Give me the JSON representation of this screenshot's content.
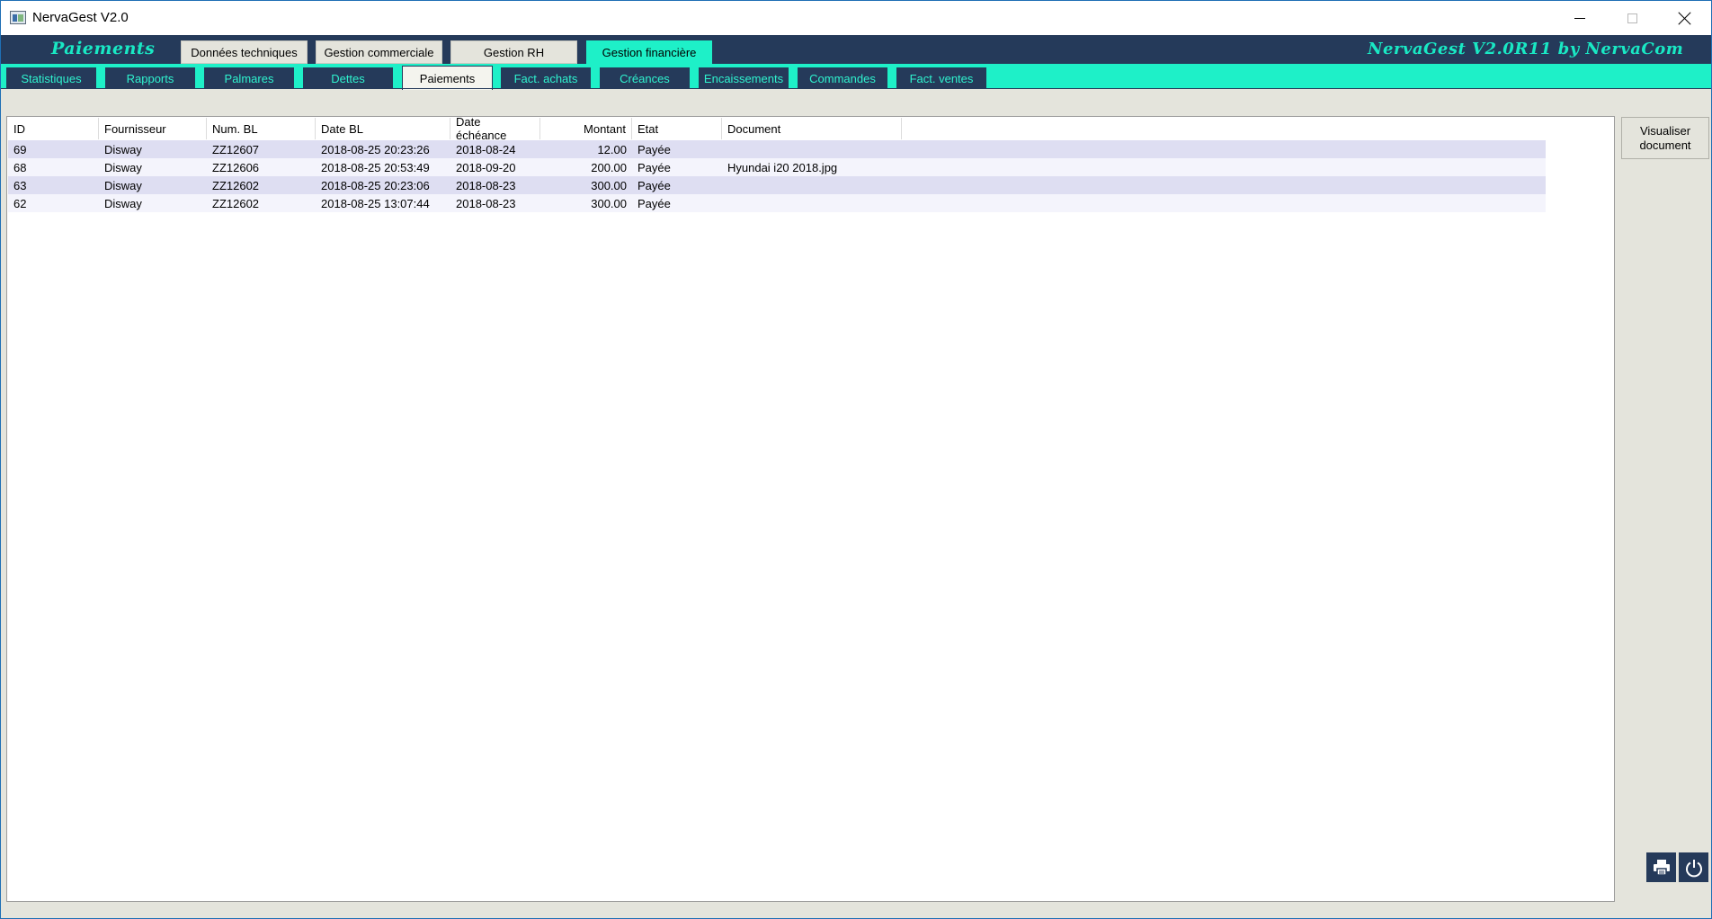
{
  "window": {
    "title": "NervaGest V2.0"
  },
  "header": {
    "section_title": "Paiements",
    "brand": "NervaGest V2.0R11 by NervaCom",
    "modules": [
      {
        "label": "Données techniques",
        "active": false
      },
      {
        "label": "Gestion commerciale",
        "active": false
      },
      {
        "label": "Gestion RH",
        "active": false
      },
      {
        "label": "Gestion financière",
        "active": true
      }
    ]
  },
  "tabs": [
    {
      "label": "Statistiques",
      "active": false
    },
    {
      "label": "Rapports",
      "active": false
    },
    {
      "label": "Palmares",
      "active": false
    },
    {
      "label": "Dettes",
      "active": false
    },
    {
      "label": "Paiements",
      "active": true
    },
    {
      "label": "Fact. achats",
      "active": false
    },
    {
      "label": "Créances",
      "active": false
    },
    {
      "label": "Encaissements",
      "active": false
    },
    {
      "label": "Commandes",
      "active": false
    },
    {
      "label": "Fact. ventes",
      "active": false
    }
  ],
  "table": {
    "columns": [
      "ID",
      "Fournisseur",
      "Num. BL",
      "Date BL",
      "Date échéance",
      "Montant",
      "Etat",
      "Document"
    ],
    "rows": [
      [
        "69",
        "Disway",
        "ZZ12607",
        "2018-08-25 20:23:26",
        "2018-08-24",
        "12.00",
        "Payée",
        ""
      ],
      [
        "68",
        "Disway",
        "ZZ12606",
        "2018-08-25 20:53:49",
        "2018-09-20",
        "200.00",
        "Payée",
        "Hyundai i20 2018.jpg"
      ],
      [
        "63",
        "Disway",
        "ZZ12602",
        "2018-08-25 20:23:06",
        "2018-08-23",
        "300.00",
        "Payée",
        ""
      ],
      [
        "62",
        "Disway",
        "ZZ12602",
        "2018-08-25 13:07:44",
        "2018-08-23",
        "300.00",
        "Payée",
        ""
      ]
    ]
  },
  "actions": {
    "view_document_line1": "Visualiser",
    "view_document_line2": "document",
    "print_icon": "printer-icon",
    "power_icon": "power-icon"
  },
  "colors": {
    "navy": "#253a5a",
    "cyan": "#1ef0c8",
    "row_alt": "#dedef2"
  }
}
